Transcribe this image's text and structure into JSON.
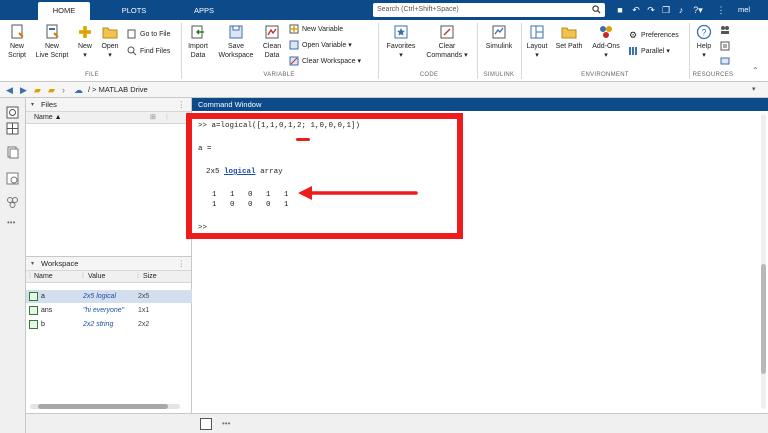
{
  "tabs": [
    {
      "label": "HOME",
      "active": true
    },
    {
      "label": "PLOTS",
      "active": false
    },
    {
      "label": "APPS",
      "active": false
    }
  ],
  "search": {
    "placeholder": "Search (Ctrl+Shift+Space)"
  },
  "user": {
    "name": "mel"
  },
  "ribbon": {
    "file": {
      "group_label": "FILE",
      "new_script": "New\nScript",
      "new_live_script": "New\nLive Script",
      "new": "New",
      "open": "Open",
      "go_to_file": "Go to File",
      "find_files": "Find Files"
    },
    "variable": {
      "group_label": "VARIABLE",
      "import_data": "Import\nData",
      "save_workspace": "Save\nWorkspace",
      "clean_data": "Clean\nData",
      "new_variable": "New Variable",
      "open_variable": "Open Variable",
      "clear_workspace": "Clear Workspace"
    },
    "code": {
      "group_label": "CODE",
      "favorites": "Favorites",
      "clear_commands": "Clear\nCommands"
    },
    "simulink": {
      "group_label": "SIMULINK",
      "simulink": "Simulink"
    },
    "environment": {
      "group_label": "ENVIRONMENT",
      "layout": "Layout",
      "set_path": "Set Path",
      "add_ons": "Add-Ons",
      "preferences": "Preferences",
      "parallel": "Parallel"
    },
    "resources": {
      "group_label": "RESOURCES",
      "help": "Help"
    }
  },
  "address": {
    "separator": "/ >",
    "location": "MATLAB Drive"
  },
  "files_panel": {
    "title": "Files",
    "col_name": "Name ▲"
  },
  "workspace_panel": {
    "title": "Workspace",
    "col_name": "Name",
    "col_value": "Value",
    "col_size": "Size",
    "rows": [
      {
        "name": "a",
        "value": "2x5 logical",
        "size": "2x5",
        "selected": true
      },
      {
        "name": "ans",
        "value": "\"hi everyone\"",
        "size": "1x1",
        "selected": false
      },
      {
        "name": "b",
        "value": "2x2 string",
        "size": "2x2",
        "selected": false
      }
    ]
  },
  "command_window": {
    "title": "Command Window",
    "prompt": ">>",
    "input": "a=logical([1,1,0,1,2; 1,0,0,0,1])",
    "output_var": "a =",
    "array_desc_prefix": "2x5",
    "array_desc_link": "logical",
    "array_desc_suffix": "array",
    "row1": "1   1   0   1   1",
    "row2": "1   0   0   0   1",
    "next_prompt": ">>"
  },
  "status": {
    "dots": "•••"
  },
  "colors": {
    "brand": "#0c4a8a",
    "highlight": "#ee1c1c",
    "link": "#1f4fa0"
  }
}
